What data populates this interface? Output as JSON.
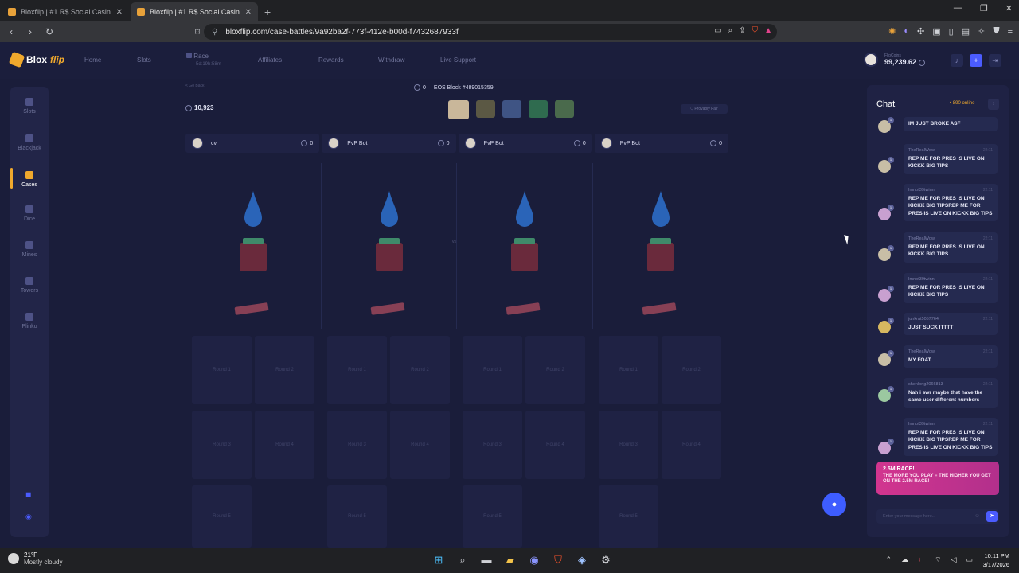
{
  "browser": {
    "tabs": [
      {
        "title": "Bloxflip | #1 R$ Social Casino & Arcade",
        "active": false
      },
      {
        "title": "Bloxflip | #1 R$ Social Casino & Arcade",
        "active": true
      }
    ],
    "url": "bloxflip.com/case-battles/9a92ba2f-773f-412e-b00d-f7432687933f"
  },
  "header": {
    "logo_a": "Blox",
    "logo_b": "flip",
    "nav": [
      "Home",
      "Slots",
      "Race",
      "Affiliates",
      "Rewards",
      "Withdraw",
      "Live Support"
    ],
    "race_timer": "5d:19h:58m",
    "balance_label": "FlipCoins",
    "balance_value": "99,239.62"
  },
  "sidebar": {
    "items": [
      {
        "label": "Slots"
      },
      {
        "label": "Blackjack"
      },
      {
        "label": "Cases",
        "active": true
      },
      {
        "label": "Dice"
      },
      {
        "label": "Mines"
      },
      {
        "label": "Towers"
      },
      {
        "label": "Plinko"
      }
    ]
  },
  "battle": {
    "back": "< Go Back",
    "round_count": "0",
    "eos_block": "EOS Block #489015359",
    "pot": "10,923",
    "fair": "Provably Fair",
    "vs": "vs",
    "players": [
      {
        "name": "cv",
        "value": "0"
      },
      {
        "name": "PvP Bot",
        "value": "0"
      },
      {
        "name": "PvP Bot",
        "value": "0"
      },
      {
        "name": "PvP Bot",
        "value": "0"
      }
    ],
    "rounds": [
      "Round 1",
      "Round 2",
      "Round 3",
      "Round 4",
      "Round 5"
    ]
  },
  "chat": {
    "title": "Chat",
    "online": "• 890 online",
    "messages": [
      {
        "user": "",
        "time": "",
        "text": "IM JUST BROKE ASF",
        "level": "1"
      },
      {
        "user": "TheRealWow",
        "time": "22:11",
        "text": "REP ME FOR PRES IS LIVE ON KICKK BIG TIPS",
        "level": "1"
      },
      {
        "user": "Imnot39twinn",
        "time": "22:11",
        "text": "REP ME FOR PRES IS LIVE ON KICKK BIG TIPSREP ME FOR PRES IS LIVE ON KICKK BIG TIPS",
        "level": "1"
      },
      {
        "user": "TheRealWow",
        "time": "22:11",
        "text": "REP ME FOR PRES IS LIVE ON KICKK BIG TIPS",
        "level": "1"
      },
      {
        "user": "Imnot39twinn",
        "time": "22:11",
        "text": "REP ME FOR PRES IS LIVE ON KICKK BIG TIPS",
        "level": "1"
      },
      {
        "user": "junkrat5057764",
        "time": "22:11",
        "text": "JUST SUCK ITTTT",
        "level": "1"
      },
      {
        "user": "TheRealWow",
        "time": "22:11",
        "text": "MY FOAT",
        "level": "1"
      },
      {
        "user": "shenlong2066813",
        "time": "22:11",
        "text": "Nah i swr maybe that have the same user different numbers",
        "level": "1"
      },
      {
        "user": "Imnot39twinn",
        "time": "22:11",
        "text": "REP ME FOR PRES IS LIVE ON KICKK BIG TIPSREP ME FOR PRES IS LIVE ON KICKK BIG TIPS",
        "level": "1"
      }
    ],
    "promo_title": "2.5M RACE!",
    "promo_text": "THE MORE YOU PLAY = THE HIGHER YOU GET ON THE 2.5M RACE!",
    "input_placeholder": "Enter your message here..."
  },
  "taskbar": {
    "temp": "21°F",
    "weather": "Mostly cloudy",
    "time": "10:11 PM",
    "date": "3/17/2026"
  },
  "colors": {
    "page_bg": "#1a1d3a",
    "accent": "#f0a92d",
    "primary_blue": "#4b5cff",
    "promo_pink": "#d2358f"
  }
}
